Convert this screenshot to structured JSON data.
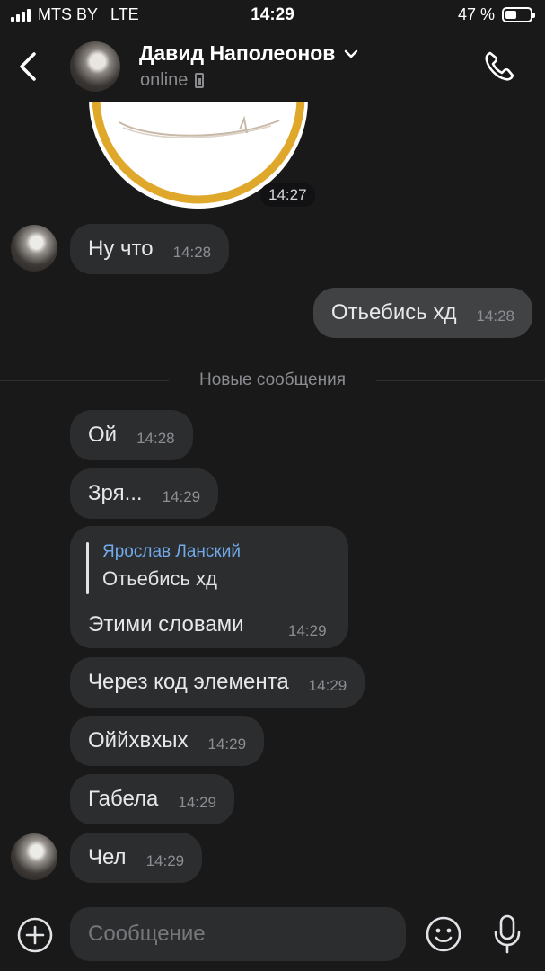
{
  "status_bar": {
    "carrier": "MTS BY",
    "network": "LTE",
    "time": "14:29",
    "battery": "47 %",
    "battery_level": 0.47
  },
  "header": {
    "contact_name": "Давид Наполеонов",
    "contact_status": "online"
  },
  "sticker": {
    "time": "14:27"
  },
  "divider": {
    "label": "Новые сообщения"
  },
  "messages": [
    {
      "text": "Ну что",
      "time": "14:28"
    },
    {
      "text": "Отьебись хд",
      "time": "14:28"
    },
    {
      "text": "Ой",
      "time": "14:28"
    },
    {
      "text": "Зря...",
      "time": "14:29"
    },
    {
      "reply_author": "Ярослав Ланский",
      "reply_quote": "Отьебись хд",
      "text": "Этими словами",
      "time": "14:29"
    },
    {
      "text": "Через код элемента",
      "time": "14:29"
    },
    {
      "text": "Оййхвхых",
      "time": "14:29"
    },
    {
      "text": "Габела",
      "time": "14:29"
    },
    {
      "text": "Чел",
      "time": "14:29"
    }
  ],
  "composer": {
    "placeholder": "Сообщение"
  },
  "colors": {
    "background": "#19191a",
    "incoming_bubble": "#2c2d2f",
    "outgoing_bubble": "#414244",
    "reply_author": "#71aaeb",
    "sticker_rim": "#e0a82a"
  },
  "icons": [
    "back-chevron-icon",
    "chevron-down-icon",
    "phone-icon",
    "call-icon",
    "plus-icon",
    "emoji-icon",
    "microphone-icon"
  ]
}
